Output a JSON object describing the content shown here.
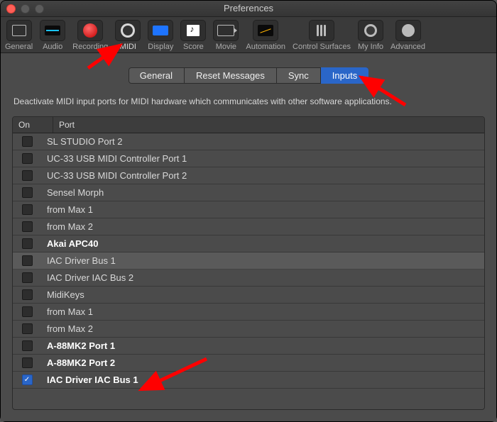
{
  "window_title": "Preferences",
  "toolbar": [
    {
      "label": "General",
      "icon": "general",
      "selected": false
    },
    {
      "label": "Audio",
      "icon": "audio",
      "selected": false
    },
    {
      "label": "Recording",
      "icon": "recording",
      "selected": false
    },
    {
      "label": "MIDI",
      "icon": "midi",
      "selected": true
    },
    {
      "label": "Display",
      "icon": "display",
      "selected": false
    },
    {
      "label": "Score",
      "icon": "score",
      "selected": false
    },
    {
      "label": "Movie",
      "icon": "movie",
      "selected": false
    },
    {
      "label": "Automation",
      "icon": "automation",
      "selected": false
    },
    {
      "label": "Control Surfaces",
      "icon": "sliders",
      "selected": false
    },
    {
      "label": "My Info",
      "icon": "user",
      "selected": false
    },
    {
      "label": "Advanced",
      "icon": "gear",
      "selected": false
    }
  ],
  "tabs": [
    {
      "label": "General",
      "selected": false
    },
    {
      "label": "Reset Messages",
      "selected": false
    },
    {
      "label": "Sync",
      "selected": false
    },
    {
      "label": "Inputs",
      "selected": true
    }
  ],
  "description": "Deactivate MIDI input ports for MIDI hardware which communicates with other software applications.",
  "columns": {
    "on": "On",
    "port": "Port"
  },
  "rows": [
    {
      "on": false,
      "port": "SL STUDIO Port 2",
      "bold": false,
      "hl": false
    },
    {
      "on": false,
      "port": "UC-33 USB MIDI Controller Port 1",
      "bold": false,
      "hl": false
    },
    {
      "on": false,
      "port": "UC-33 USB MIDI Controller Port 2",
      "bold": false,
      "hl": false
    },
    {
      "on": false,
      "port": "Sensel Morph",
      "bold": false,
      "hl": false
    },
    {
      "on": false,
      "port": "from Max 1",
      "bold": false,
      "hl": false
    },
    {
      "on": false,
      "port": "from Max 2",
      "bold": false,
      "hl": false
    },
    {
      "on": false,
      "port": "Akai APC40",
      "bold": true,
      "hl": false
    },
    {
      "on": false,
      "port": "IAC Driver Bus 1",
      "bold": false,
      "hl": true
    },
    {
      "on": false,
      "port": "IAC Driver IAC Bus 2",
      "bold": false,
      "hl": false
    },
    {
      "on": false,
      "port": "MidiKeys",
      "bold": false,
      "hl": false
    },
    {
      "on": false,
      "port": "from Max 1",
      "bold": false,
      "hl": false
    },
    {
      "on": false,
      "port": "from Max 2",
      "bold": false,
      "hl": false
    },
    {
      "on": false,
      "port": "A-88MK2 Port 1",
      "bold": true,
      "hl": false
    },
    {
      "on": false,
      "port": "A-88MK2 Port 2",
      "bold": true,
      "hl": false
    },
    {
      "on": true,
      "port": "IAC Driver IAC Bus 1",
      "bold": true,
      "hl": false
    }
  ],
  "colors": {
    "accent": "#2a66c8",
    "arrow": "#ff0000"
  }
}
